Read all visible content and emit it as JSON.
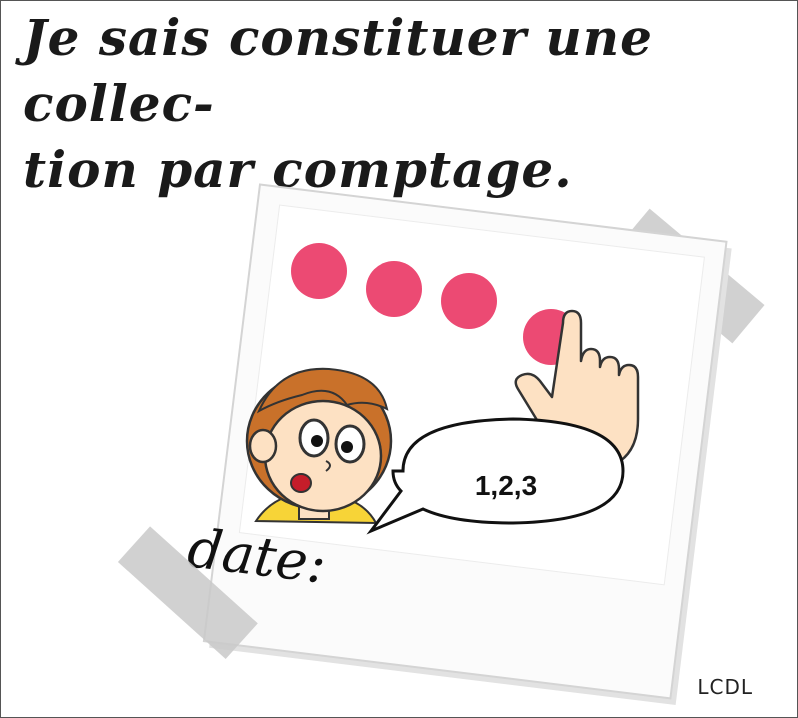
{
  "title": {
    "line1": "Je sais constituer une collec-",
    "line2": "tion par comptage."
  },
  "photo": {
    "dots_count": 4,
    "dot_color": "#ec4a73",
    "speech_text": "1,2,3",
    "date_label": "date:"
  },
  "credit": "LCDL",
  "colors": {
    "tape": "#c9c9c9",
    "photo_frame": "#fbfbfb",
    "hair": "#c9712a",
    "skin": "#fde1c3",
    "shirt": "#f7d437"
  }
}
